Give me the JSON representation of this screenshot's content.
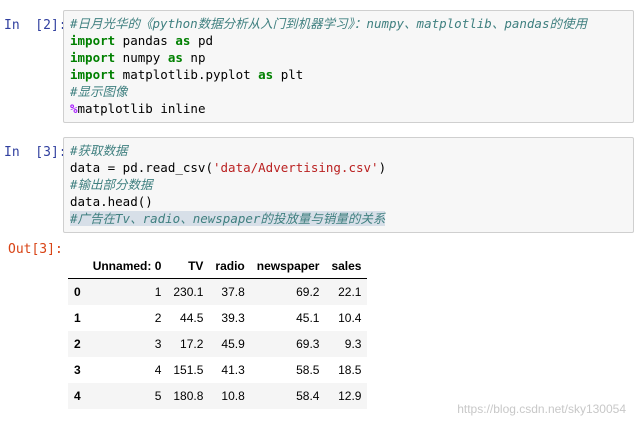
{
  "cell1": {
    "prompt": "In  [2]:",
    "lines": [
      {
        "comment": "#日月光华的《python数据分析从入门到机器学习》：numpy、matplotlib、pandas的使用"
      },
      {
        "kw": "import",
        "a": " pandas ",
        "kw2": "as",
        "b": " pd"
      },
      {
        "kw": "import",
        "a": " numpy ",
        "kw2": "as",
        "b": " np"
      },
      {
        "kw": "import",
        "a": " matplotlib.pyplot ",
        "kw2": "as",
        "b": " plt"
      },
      {
        "comment": "#显示图像"
      },
      {
        "magic": "%",
        "rest": "matplotlib inline"
      }
    ]
  },
  "cell2": {
    "prompt": "In  [3]:",
    "lines": [
      {
        "comment": "#获取数据"
      },
      {
        "a": "data = pd.read_csv(",
        "str": "'data/Advertising.csv'",
        "b": ")"
      },
      {
        "comment": "#输出部分数据"
      },
      {
        "a": "data.head()"
      },
      {
        "comment": "#广告在Tv、radio、newspaper的投放量与销量的关系"
      }
    ]
  },
  "output": {
    "prompt": "Out[3]:",
    "columns": [
      "",
      "Unnamed: 0",
      "TV",
      "radio",
      "newspaper",
      "sales"
    ],
    "rows": [
      [
        "0",
        "1",
        "230.1",
        "37.8",
        "69.2",
        "22.1"
      ],
      [
        "1",
        "2",
        "44.5",
        "39.3",
        "45.1",
        "10.4"
      ],
      [
        "2",
        "3",
        "17.2",
        "45.9",
        "69.3",
        "9.3"
      ],
      [
        "3",
        "4",
        "151.5",
        "41.3",
        "58.5",
        "18.5"
      ],
      [
        "4",
        "5",
        "180.8",
        "10.8",
        "58.4",
        "12.9"
      ]
    ]
  },
  "watermark": "https://blog.csdn.net/sky130054"
}
